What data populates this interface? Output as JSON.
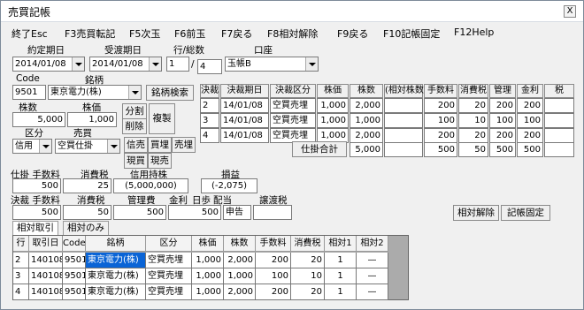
{
  "window": {
    "title": "売買記帳",
    "close": "X"
  },
  "menu": [
    "終了Esc",
    "F3売買転記",
    "F5次玉",
    "F6前玉",
    "F7戻る",
    "F8相対解除",
    "F9戻る",
    "F10記帳固定",
    "F12Help"
  ],
  "labels": {
    "contract_date": "約定期日",
    "receipt_date": "受渡期日",
    "row_total": "行/総数",
    "account": "口座",
    "code": "Code",
    "brand": "銘柄",
    "shares": "株数",
    "price": "株価",
    "category": "区分",
    "trade": "売買",
    "open_commission": "仕掛 手数料",
    "consumption_tax": "消費税",
    "credit_holding": "信用持株",
    "profit_loss": "損益",
    "settle_commission": "決裁 手数料",
    "settle_tax": "消費税",
    "mgmt_fee": "管理費",
    "interest": "金利",
    "days": "日歩",
    "dividend": "配当",
    "transfer_tax": "譲渡税"
  },
  "form": {
    "contract_date": "2014/01/08",
    "receipt_date": "2014/01/08",
    "row": "1",
    "total": "4",
    "account": "玉帳B",
    "code": "9501",
    "brand": "東京電力(株)",
    "shares": "5,000",
    "price": "1,000",
    "category": "信用",
    "trade": "空買仕掛"
  },
  "buttons": {
    "brand_search": "銘柄検索",
    "split": "分割",
    "delete": "削除",
    "copy": "複製",
    "shinbai": "信売",
    "shinkai": "買埋",
    "sell": "売埋",
    "genkai": "現買",
    "genbiki": "現売",
    "relative_release": "相対解除",
    "fix_entry": "記帳固定",
    "open_total": "仕掛合計"
  },
  "summary": {
    "open_commission": "500",
    "consumption_tax": "25",
    "credit_holding": "(5,000,000)",
    "profit_loss": "(-2,075)",
    "settle_commission": "500",
    "settle_tax": "50",
    "mgmt_fee": "500",
    "interest_days": "500",
    "dividend": "申告"
  },
  "right_table": {
    "headers": [
      "決裁",
      "決裁期日",
      "決裁区分",
      "株価",
      "株数",
      "(相対株数)",
      "手数料",
      "消費税",
      "管理",
      "金利",
      "税"
    ],
    "rows": [
      [
        "2",
        "14/01/08",
        "空買売埋",
        "1,000",
        "2,000",
        "",
        "200",
        "20",
        "200",
        "200",
        ""
      ],
      [
        "3",
        "14/01/08",
        "空買売埋",
        "1,000",
        "1,000",
        "",
        "100",
        "10",
        "100",
        "100",
        ""
      ],
      [
        "4",
        "14/01/08",
        "空買売埋",
        "1,000",
        "2,000",
        "",
        "200",
        "20",
        "200",
        "200",
        ""
      ]
    ],
    "totals": [
      "5,000",
      "500",
      "50",
      "500",
      "500"
    ]
  },
  "tabs": [
    "相対取引",
    "相対のみ"
  ],
  "grid": {
    "headers": [
      "行",
      "取引日",
      "Code",
      "銘柄",
      "区分",
      "株価",
      "株数",
      "手数料",
      "消費税",
      "相対1",
      "相対2"
    ],
    "rows": [
      [
        "2",
        "140108",
        "9501",
        "東京電力(株)",
        "空買売埋",
        "1,000",
        "2,000",
        "200",
        "20",
        "1",
        "—"
      ],
      [
        "3",
        "140108",
        "9501",
        "東京電力(株)",
        "空買売埋",
        "1,000",
        "1,000",
        "100",
        "10",
        "1",
        "—"
      ],
      [
        "4",
        "140108",
        "9501",
        "東京電力(株)",
        "空買売埋",
        "1,000",
        "2,000",
        "200",
        "20",
        "1",
        "—"
      ]
    ]
  }
}
